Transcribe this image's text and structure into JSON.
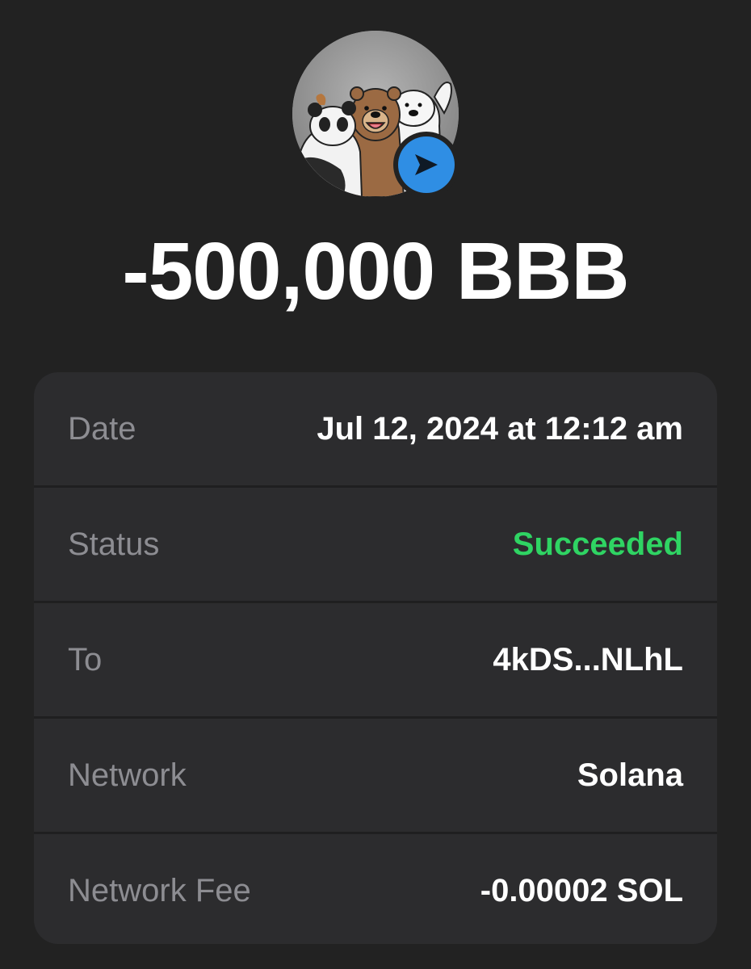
{
  "transaction": {
    "amount": "-500,000 BBB",
    "avatar_icon": "we-bare-bears-avatar",
    "badge_icon": "send-arrow-icon",
    "badge_color": "#2f8ee4"
  },
  "details": {
    "rows": [
      {
        "label": "Date",
        "value": "Jul 12, 2024 at 12:12 am"
      },
      {
        "label": "Status",
        "value": "Succeeded",
        "color": "#2fd463"
      },
      {
        "label": "To",
        "value": "4kDS...NLhL"
      },
      {
        "label": "Network",
        "value": "Solana"
      },
      {
        "label": "Network Fee",
        "value": "-0.00002 SOL"
      }
    ]
  },
  "colors": {
    "background": "#222222",
    "card": "#2c2c2e",
    "label": "#8d8d92",
    "success": "#2fd463"
  }
}
